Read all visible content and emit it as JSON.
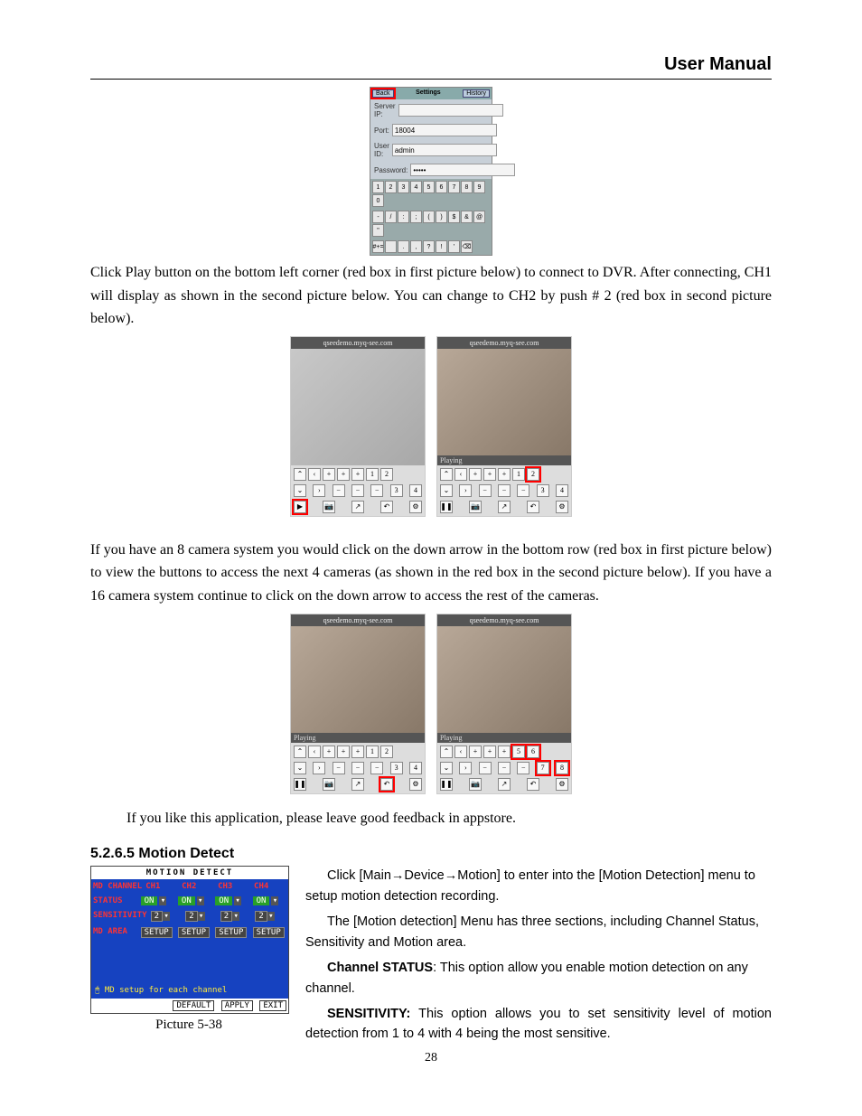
{
  "header": {
    "title": "User Manual"
  },
  "settings_phone": {
    "back": "Back",
    "title": "Settings",
    "history": "History",
    "server_ip_label": "Server IP:",
    "server_ip_value": "",
    "port_label": "Port:",
    "port_value": "18004",
    "user_id_label": "User ID:",
    "user_id_value": "admin",
    "password_label": "Password:",
    "password_value": "•••••",
    "keys_row1": [
      "1",
      "2",
      "3",
      "4",
      "5",
      "6",
      "7",
      "8",
      "9",
      "0"
    ],
    "keys_row2": [
      "-",
      "/",
      ":",
      ";",
      "(",
      ")",
      "$",
      "&",
      "@",
      "\""
    ],
    "keys_row3": [
      "#+=",
      " ",
      ".",
      ",",
      "?",
      "!",
      "'",
      "⌫"
    ]
  },
  "para1": "Click Play button on the bottom left corner (red box in first picture below) to connect to DVR.   After connecting, CH1 will display as shown in the second picture below. You can change to CH2 by push # 2 (red box in second picture below).",
  "thumbs1": {
    "url": "qseedemo.myq-see.com",
    "playing": "Playing",
    "nav": [
      "⌃",
      "‹",
      "+",
      "+",
      "+",
      "1",
      "2"
    ],
    "nav2": [
      "⌄",
      "›",
      "−",
      "−",
      "−",
      "3",
      "4"
    ],
    "bottom": [
      "▶",
      "📷",
      "↗",
      "↶",
      "⚙"
    ]
  },
  "para2": "If you have an 8 camera system you would click on the down arrow in the bottom row (red box in first picture below) to view the buttons to access the next 4 cameras (as shown in the red box in the second picture below). If you have a 16 camera system continue to click on the down arrow to access the rest of the cameras.",
  "thumbs2": {
    "url": "qseedemo.myq-see.com",
    "playing": "Playing",
    "navA": [
      "⌃",
      "‹",
      "+",
      "+",
      "+",
      "1",
      "2"
    ],
    "navB": [
      "⌄",
      "›",
      "−",
      "−",
      "−",
      "3",
      "4"
    ],
    "navC": [
      "⌃",
      "‹",
      "+",
      "+",
      "+",
      "5",
      "6"
    ],
    "navD": [
      "⌄",
      "›",
      "−",
      "−",
      "−",
      "7",
      "8"
    ],
    "bottom": [
      "❚❚",
      "📷",
      "↗",
      "↶",
      "⚙"
    ]
  },
  "para3": "If you like this application, please leave good feedback in appstore.",
  "section_heading": "5.2.6.5 Motion Detect",
  "md_panel": {
    "title": "MOTION DETECT",
    "row_labels": [
      "MD CHANNEL",
      "STATUS",
      "SENSITIVITY",
      "MD AREA"
    ],
    "channels": [
      "CH1",
      "CH2",
      "CH3",
      "CH4"
    ],
    "status": [
      "ON",
      "ON",
      "ON",
      "ON"
    ],
    "sensitivity": [
      "2",
      "2",
      "2",
      "2"
    ],
    "area": [
      "SETUP",
      "SETUP",
      "SETUP",
      "SETUP"
    ],
    "note": "MD setup for each channel",
    "buttons": [
      "DEFAULT",
      "APPLY",
      "EXIT"
    ],
    "caption": "Picture 5-38"
  },
  "right": {
    "p1a": "Click [Main",
    "p1b": "Device",
    "p1c": "Motion] to enter into the [Motion Detection] menu to setup motion detection recording.",
    "p2": "The [Motion detection] Menu has three sections, including Channel Status, Sensitivity and Motion area.",
    "p3_label": "Channel STATUS",
    "p3_text": ": This option allow you enable motion detection on any channel.",
    "p4_label": "SENSITIVITY:",
    "p4_text": " This option allows you to set sensitivity level of motion detection from 1 to 4 with 4 being the most sensitive."
  },
  "page_number": "28"
}
